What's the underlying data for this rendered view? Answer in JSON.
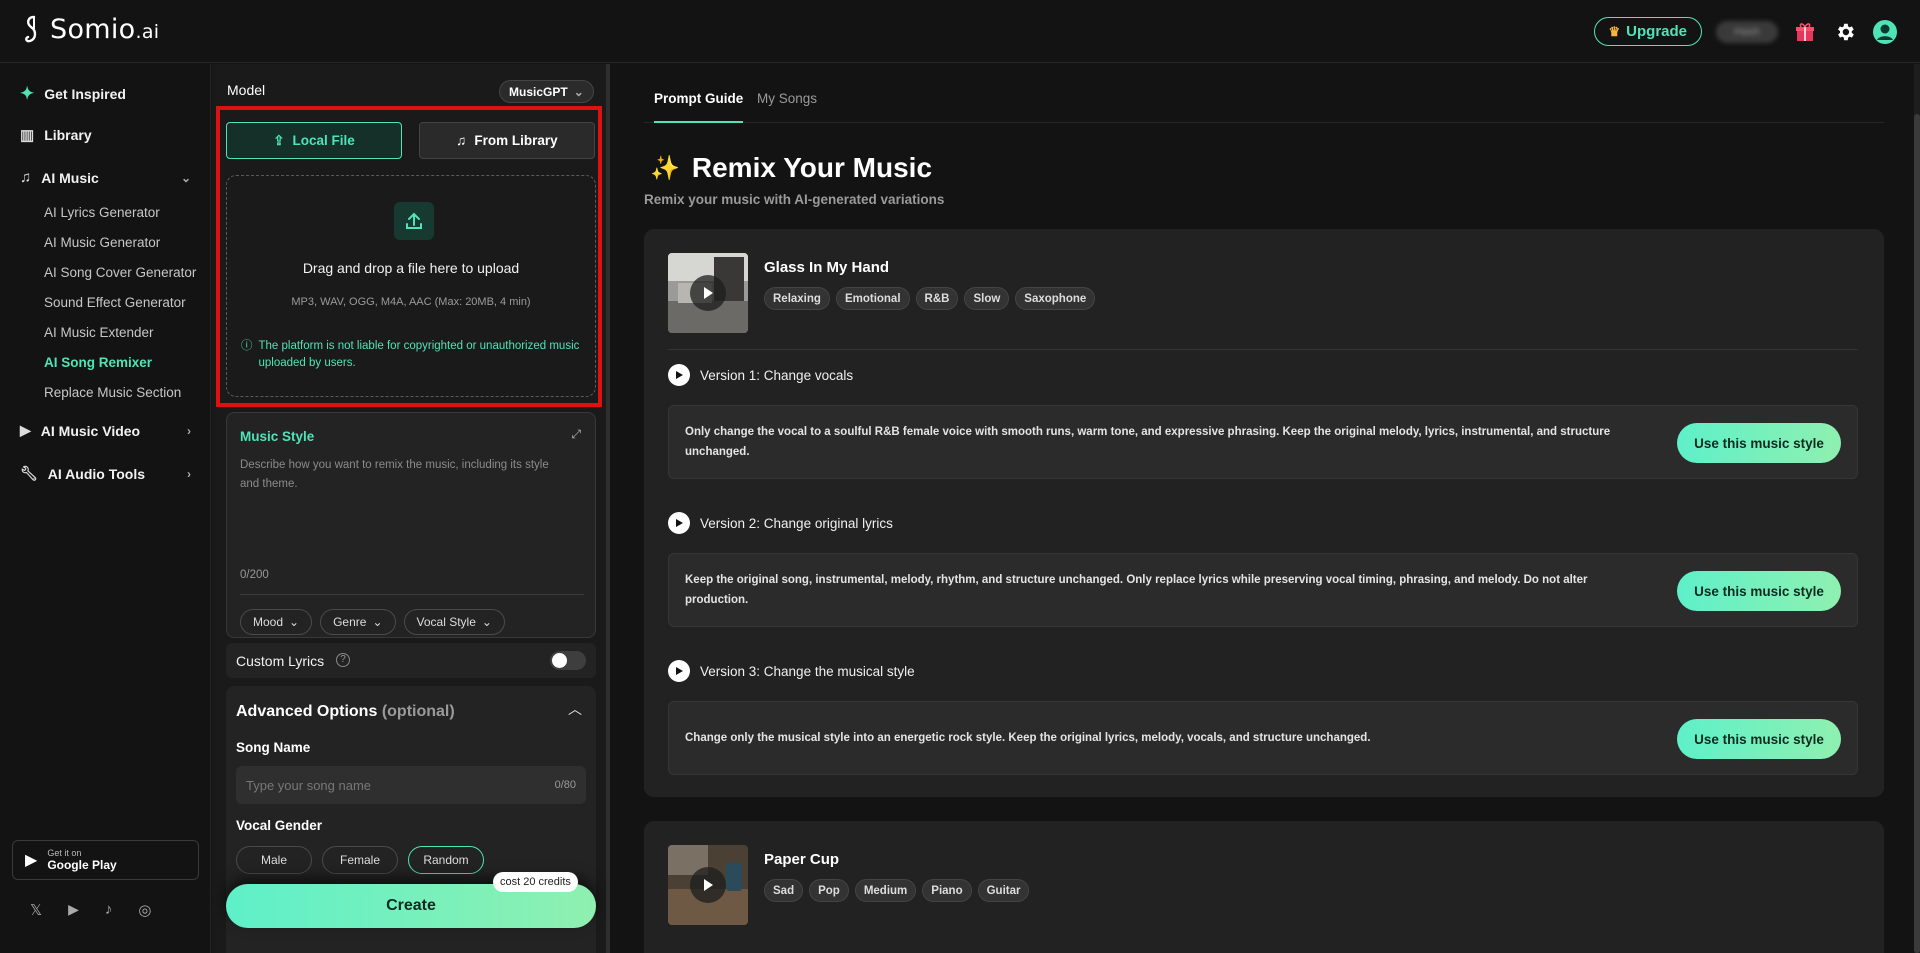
{
  "header": {
    "logo_main": "Somio",
    "logo_suffix": ".ai",
    "upgrade_label": "Upgrade",
    "credits_blurred": "Hash",
    "accent": "#4fe3b5"
  },
  "sidebar": {
    "top_items": [
      {
        "label": "Get Inspired",
        "icon": "sparkle-icon"
      },
      {
        "label": "Library",
        "icon": "library-icon"
      },
      {
        "label": "AI Music",
        "icon": "music-note-icon"
      }
    ],
    "ai_music_subitems": [
      "AI Lyrics Generator",
      "AI Music Generator",
      "AI Song Cover Generator",
      "Sound Effect Generator",
      "AI Music Extender",
      "AI Song Remixer",
      "Replace Music Section"
    ],
    "active_subitem": "AI Song Remixer",
    "bottom_items": [
      {
        "label": "AI Music Video",
        "icon": "video-icon"
      },
      {
        "label": "AI Audio Tools",
        "icon": "wrench-icon"
      }
    ],
    "google_play_small": "Get it on",
    "google_play_big": "Google Play"
  },
  "form": {
    "model_label": "Model",
    "model_value": "MusicGPT",
    "local_file_label": "Local File",
    "from_library_label": "From Library",
    "drop_title": "Drag and drop a file here to upload",
    "drop_formats": "MP3, WAV, OGG, M4A, AAC (Max: 20MB, 4 min)",
    "drop_note": "The platform is not liable for copyrighted or unauthorized music uploaded by users.",
    "music_style_title": "Music Style",
    "music_style_placeholder": "Describe how you want to remix the music, including its style and theme.",
    "music_style_counter": "0/200",
    "chips": [
      "Mood",
      "Genre",
      "Vocal Style"
    ],
    "custom_lyrics_label": "Custom Lyrics",
    "advanced_title": "Advanced Options",
    "advanced_optional": "(optional)",
    "song_name_label": "Song Name",
    "song_name_placeholder": "Type your song name",
    "song_name_counter": "0/80",
    "vocal_gender_label": "Vocal Gender",
    "vocal_gender_options": [
      "Male",
      "Female",
      "Random"
    ],
    "cost_badge": "cost 20 credits",
    "create_label": "Create"
  },
  "main": {
    "tabs": [
      "Prompt Guide",
      "My Songs"
    ],
    "hero_title": "Remix Your Music",
    "hero_subtitle": "Remix your music with AI-generated variations",
    "song1": {
      "title": "Glass In My Hand",
      "tags": [
        "Relaxing",
        "Emotional",
        "R&B",
        "Slow",
        "Saxophone"
      ],
      "versions": [
        {
          "heading": "Version 1: Change vocals",
          "text": "Only change the vocal to a soulful R&B female voice with smooth runs, warm tone, and expressive phrasing. Keep the original melody, lyrics, instrumental, and structure unchanged."
        },
        {
          "heading": "Version 2: Change original lyrics",
          "text": "Keep the original song, instrumental, melody, rhythm, and structure unchanged. Only replace lyrics while preserving vocal timing, phrasing, and melody. Do not alter production."
        },
        {
          "heading": "Version 3: Change the musical style",
          "text": "Change only the musical style into an energetic rock style. Keep the original lyrics, melody, vocals, and structure unchanged."
        }
      ],
      "use_label": "Use this music style"
    },
    "song2": {
      "title": "Paper Cup",
      "tags": [
        "Sad",
        "Pop",
        "Medium",
        "Piano",
        "Guitar"
      ]
    }
  }
}
